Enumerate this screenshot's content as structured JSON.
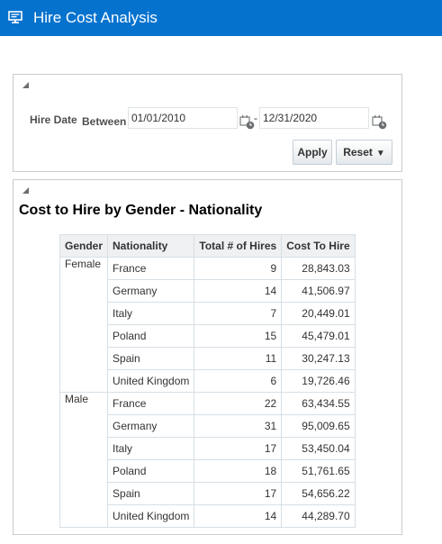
{
  "app": {
    "title": "Hire Cost Analysis",
    "icon": "monitor-icon"
  },
  "prompts": {
    "hire_date_label": "Hire Date",
    "between_label": "Between",
    "start_date": "01/01/2010",
    "end_date": "12/31/2020",
    "separator": "-",
    "apply_label": "Apply",
    "reset_label": "Reset",
    "reset_caret": "▼"
  },
  "report": {
    "title": "Cost to Hire by Gender - Nationality",
    "columns": [
      "Gender",
      "Nationality",
      "Total # of Hires",
      "Cost To Hire"
    ],
    "groups": [
      {
        "gender": "Female",
        "rows": [
          {
            "nationality": "France",
            "hires": "9",
            "cost": "28,843.03"
          },
          {
            "nationality": "Germany",
            "hires": "14",
            "cost": "41,506.97"
          },
          {
            "nationality": "Italy",
            "hires": "7",
            "cost": "20,449.01"
          },
          {
            "nationality": "Poland",
            "hires": "15",
            "cost": "45,479.01"
          },
          {
            "nationality": "Spain",
            "hires": "11",
            "cost": "30,247.13"
          },
          {
            "nationality": "United Kingdom",
            "hires": "6",
            "cost": "19,726.46"
          }
        ]
      },
      {
        "gender": "Male",
        "rows": [
          {
            "nationality": "France",
            "hires": "22",
            "cost": "63,434.55"
          },
          {
            "nationality": "Germany",
            "hires": "31",
            "cost": "95,009.65"
          },
          {
            "nationality": "Italy",
            "hires": "17",
            "cost": "53,450.04"
          },
          {
            "nationality": "Poland",
            "hires": "18",
            "cost": "51,761.65"
          },
          {
            "nationality": "Spain",
            "hires": "17",
            "cost": "54,656.22"
          },
          {
            "nationality": "United Kingdom",
            "hires": "14",
            "cost": "44,289.70"
          }
        ]
      }
    ]
  },
  "colors": {
    "titlebar": "#0572ce",
    "link_value": "#1e5c8e"
  }
}
